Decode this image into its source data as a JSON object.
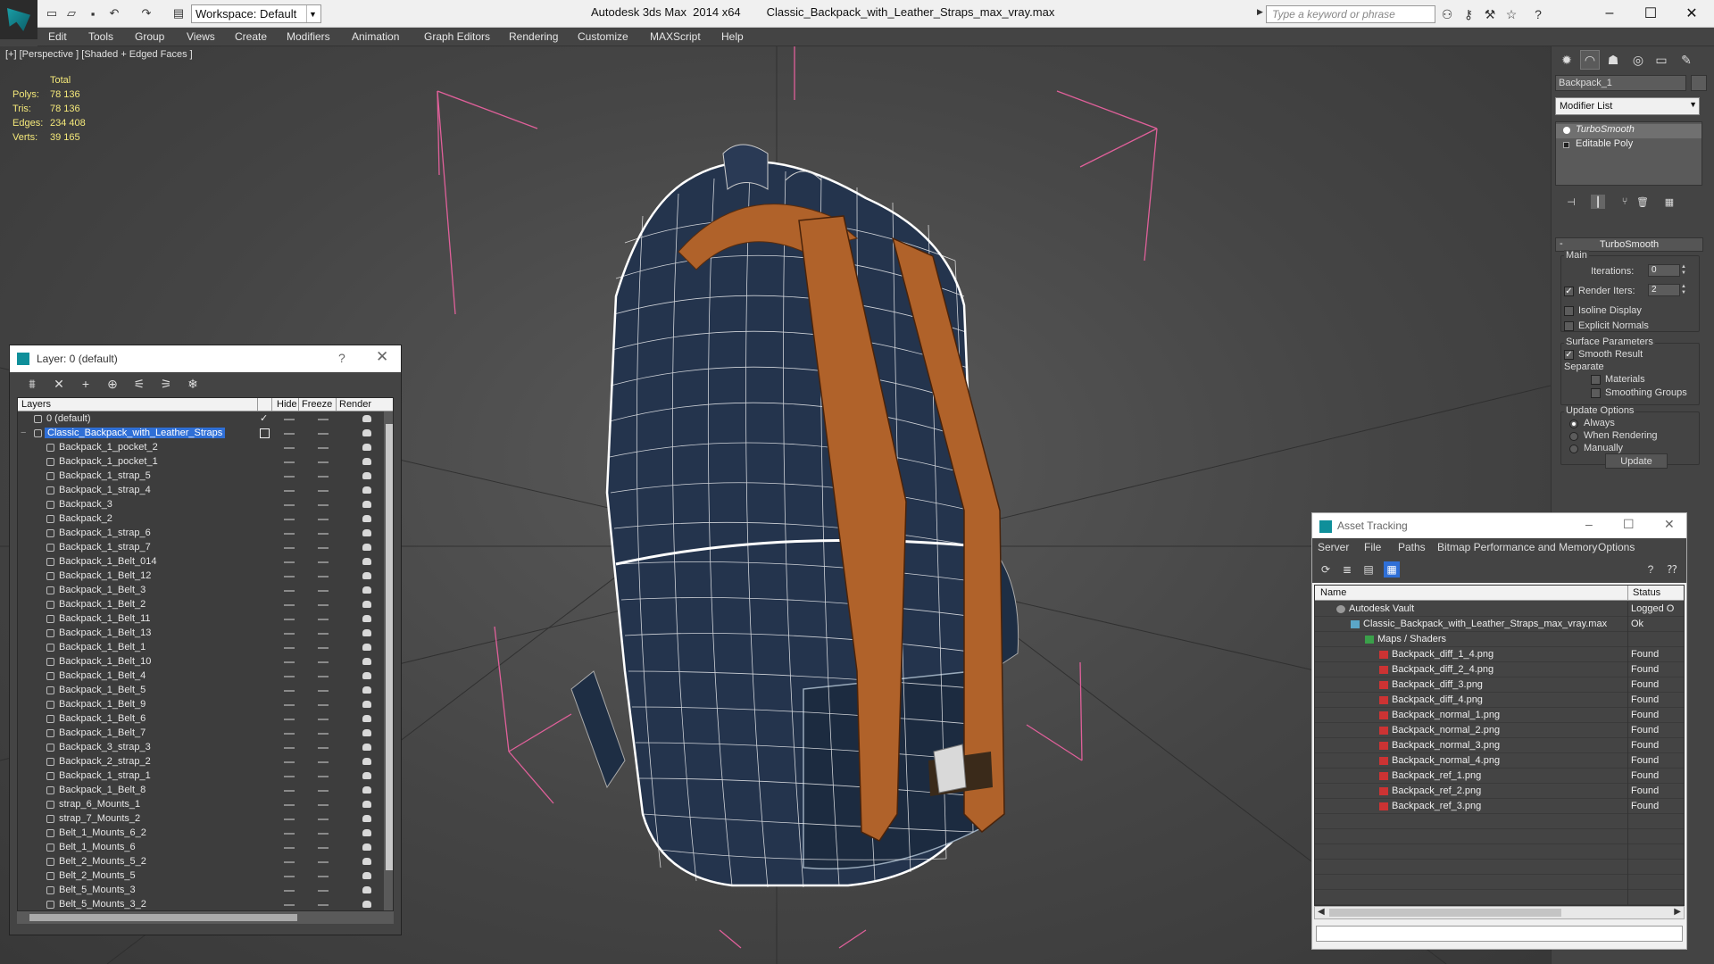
{
  "titlebar": {
    "workspace": "Workspace: Default",
    "app_title": "Autodesk 3ds Max  2014 x64",
    "file_title": "Classic_Backpack_with_Leather_Straps_max_vray.max",
    "search_placeholder": "Type a keyword or phrase"
  },
  "menu": [
    "Edit",
    "Tools",
    "Group",
    "Views",
    "Create",
    "Modifiers",
    "Animation",
    "Graph Editors",
    "Rendering",
    "Customize",
    "MAXScript",
    "Help"
  ],
  "viewport": {
    "label": "[+] [Perspective ] [Shaded + Edged Faces ]",
    "stats": {
      "header": "Total",
      "rows": [
        {
          "label": "Polys:",
          "value": "78 136"
        },
        {
          "label": "Tris:",
          "value": "78 136"
        },
        {
          "label": "Edges:",
          "value": "234 408"
        },
        {
          "label": "Verts:",
          "value": "39 165"
        }
      ]
    }
  },
  "layer_dialog": {
    "title": "Layer: 0 (default)",
    "help": "?",
    "columns": {
      "layers": "Layers",
      "hide": "Hide",
      "freeze": "Freeze",
      "render": "Render"
    },
    "default_layer": "0 (default)",
    "selected_layer": "Classic_Backpack_with_Leather_Straps",
    "objects": [
      "Backpack_1_pocket_2",
      "Backpack_1_pocket_1",
      "Backpack_1_strap_5",
      "Backpack_1_strap_4",
      "Backpack_3",
      "Backpack_2",
      "Backpack_1_strap_6",
      "Backpack_1_strap_7",
      "Backpack_1_Belt_014",
      "Backpack_1_Belt_12",
      "Backpack_1_Belt_3",
      "Backpack_1_Belt_2",
      "Backpack_1_Belt_11",
      "Backpack_1_Belt_13",
      "Backpack_1_Belt_1",
      "Backpack_1_Belt_10",
      "Backpack_1_Belt_4",
      "Backpack_1_Belt_5",
      "Backpack_1_Belt_9",
      "Backpack_1_Belt_6",
      "Backpack_1_Belt_7",
      "Backpack_3_strap_3",
      "Backpack_2_strap_2",
      "Backpack_1_strap_1",
      "Backpack_1_Belt_8",
      "strap_6_Mounts_1",
      "strap_7_Mounts_2",
      "Belt_1_Mounts_6_2",
      "Belt_1_Mounts_6",
      "Belt_2_Mounts_5_2",
      "Belt_2_Mounts_5",
      "Belt_5_Mounts_3",
      "Belt_5_Mounts_3_2"
    ]
  },
  "command_panel": {
    "object_name": "Backpack_1",
    "modifier_list": "Modifier List",
    "stack": [
      "TurboSmooth",
      "Editable Poly"
    ],
    "rollout_title": "TurboSmooth",
    "main_group": "Main",
    "iterations_label": "Iterations:",
    "iterations_value": "0",
    "render_iters_label": "Render Iters:",
    "render_iters_value": "2",
    "render_iters_checked": true,
    "isoline_label": "Isoline Display",
    "explicit_normals_label": "Explicit Normals",
    "surface_group": "Surface Parameters",
    "smooth_result_label": "Smooth Result",
    "separate_label": "Separate",
    "materials_label": "Materials",
    "smoothing_groups_label": "Smoothing Groups",
    "update_group": "Update Options",
    "update_always": "Always",
    "update_when_rendering": "When Rendering",
    "update_manually": "Manually",
    "update_button": "Update"
  },
  "asset_dialog": {
    "title": "Asset Tracking",
    "menu": [
      "Server",
      "File",
      "Paths",
      "Bitmap Performance and Memory",
      "Options"
    ],
    "columns": {
      "name": "Name",
      "status": "Status"
    },
    "rows": [
      {
        "name": "Autodesk Vault",
        "status": "Logged O",
        "indent": 1,
        "icon": "vault"
      },
      {
        "name": "Classic_Backpack_with_Leather_Straps_max_vray.max",
        "status": "Ok",
        "indent": 2,
        "icon": "max"
      },
      {
        "name": "Maps / Shaders",
        "status": "",
        "indent": 3,
        "icon": "maps"
      },
      {
        "name": "Backpack_diff_1_4.png",
        "status": "Found",
        "indent": 4,
        "icon": "png"
      },
      {
        "name": "Backpack_diff_2_4.png",
        "status": "Found",
        "indent": 4,
        "icon": "png"
      },
      {
        "name": "Backpack_diff_3.png",
        "status": "Found",
        "indent": 4,
        "icon": "png"
      },
      {
        "name": "Backpack_diff_4.png",
        "status": "Found",
        "indent": 4,
        "icon": "png"
      },
      {
        "name": "Backpack_normal_1.png",
        "status": "Found",
        "indent": 4,
        "icon": "png"
      },
      {
        "name": "Backpack_normal_2.png",
        "status": "Found",
        "indent": 4,
        "icon": "png"
      },
      {
        "name": "Backpack_normal_3.png",
        "status": "Found",
        "indent": 4,
        "icon": "png"
      },
      {
        "name": "Backpack_normal_4.png",
        "status": "Found",
        "indent": 4,
        "icon": "png"
      },
      {
        "name": "Backpack_ref_1.png",
        "status": "Found",
        "indent": 4,
        "icon": "png"
      },
      {
        "name": "Backpack_ref_2.png",
        "status": "Found",
        "indent": 4,
        "icon": "png"
      },
      {
        "name": "Backpack_ref_3.png",
        "status": "Found",
        "indent": 4,
        "icon": "png"
      }
    ]
  }
}
